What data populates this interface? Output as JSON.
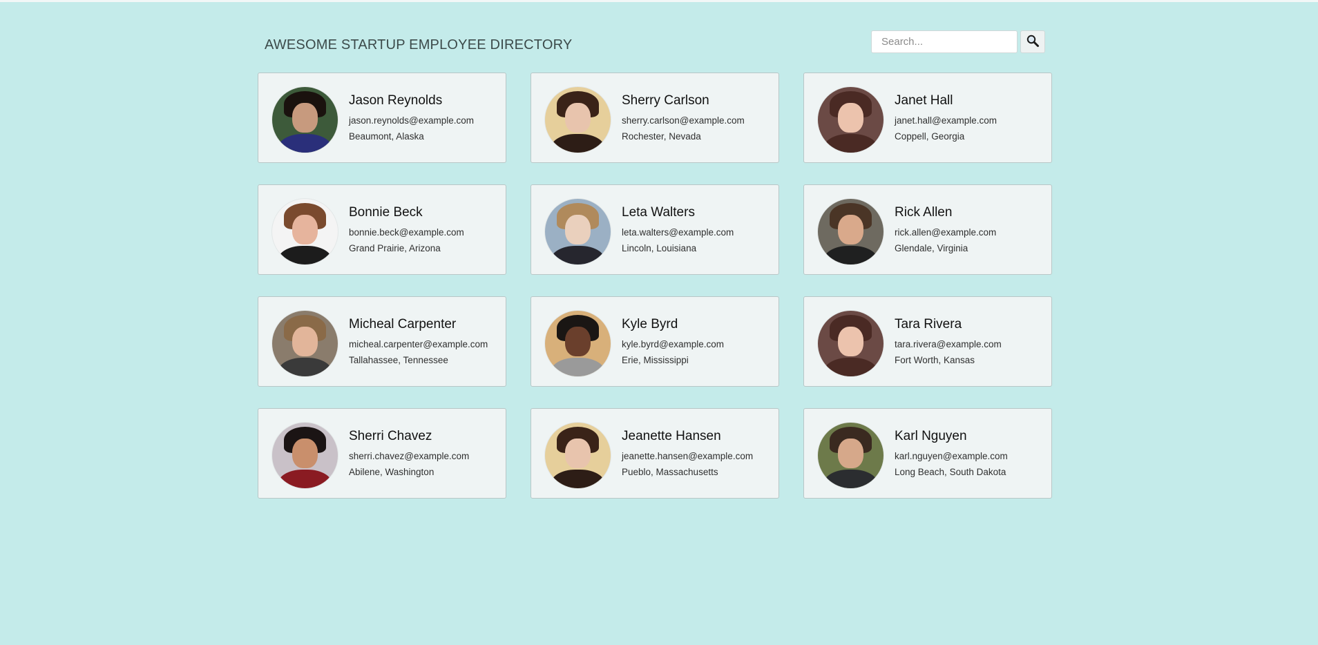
{
  "header": {
    "title": "Awesome Startup Employee Directory",
    "search_placeholder": "Search...",
    "search_icon": "magnifying-glass-icon"
  },
  "colors": {
    "background": "#c4ebea",
    "card": "#eff4f4",
    "card_border": "#b8c6c6"
  },
  "employees": [
    {
      "name": "Jason Reynolds",
      "email": "jason.reynolds@example.com",
      "location": "Beaumont, Alaska",
      "avatar": {
        "bg": "#3d5a3a",
        "hair": "#1a120e",
        "skin": "#c79a7e",
        "body": "#2a2f7a"
      }
    },
    {
      "name": "Sherry Carlson",
      "email": "sherry.carlson@example.com",
      "location": "Rochester, Nevada",
      "avatar": {
        "bg": "#e6cf9b",
        "hair": "#3a2318",
        "skin": "#e8c4ad",
        "body": "#2d1d16"
      }
    },
    {
      "name": "Janet Hall",
      "email": "janet.hall@example.com",
      "location": "Coppell, Georgia",
      "avatar": {
        "bg": "#6b4a45",
        "hair": "#4a2a24",
        "skin": "#ecc3ad",
        "body": "#4a2a24"
      }
    },
    {
      "name": "Bonnie Beck",
      "email": "bonnie.beck@example.com",
      "location": "Grand Prairie, Arizona",
      "avatar": {
        "bg": "#f4f4f4",
        "hair": "#7a4a2e",
        "skin": "#e6b49d",
        "body": "#1c1c1c"
      }
    },
    {
      "name": "Leta Walters",
      "email": "leta.walters@example.com",
      "location": "Lincoln, Louisiana",
      "avatar": {
        "bg": "#9bb0c4",
        "hair": "#b08a5c",
        "skin": "#ead0bd",
        "body": "#26262e"
      }
    },
    {
      "name": "Rick Allen",
      "email": "rick.allen@example.com",
      "location": "Glendale, Virginia",
      "avatar": {
        "bg": "#6e6a60",
        "hair": "#4a3526",
        "skin": "#d9a98b",
        "body": "#1f2020"
      }
    },
    {
      "name": "Micheal Carpenter",
      "email": "micheal.carpenter@example.com",
      "location": "Tallahassee, Tennessee",
      "avatar": {
        "bg": "#8a7c6c",
        "hair": "#8a6a48",
        "skin": "#e2b59a",
        "body": "#3a3a3a"
      }
    },
    {
      "name": "Kyle Byrd",
      "email": "kyle.byrd@example.com",
      "location": "Erie, Mississippi",
      "avatar": {
        "bg": "#d8b07a",
        "hair": "#1a1614",
        "skin": "#6a3f2c",
        "body": "#9a9a9a"
      }
    },
    {
      "name": "Tara Rivera",
      "email": "tara.rivera@example.com",
      "location": "Fort Worth, Kansas",
      "avatar": {
        "bg": "#6b4a45",
        "hair": "#4a2a24",
        "skin": "#ecc3ad",
        "body": "#4a2a24"
      }
    },
    {
      "name": "Sherri Chavez",
      "email": "sherri.chavez@example.com",
      "location": "Abilene, Washington",
      "avatar": {
        "bg": "#c9c1c8",
        "hair": "#1b1414",
        "skin": "#c98f6c",
        "body": "#8a1b22"
      }
    },
    {
      "name": "Jeanette Hansen",
      "email": "jeanette.hansen@example.com",
      "location": "Pueblo, Massachusetts",
      "avatar": {
        "bg": "#e6cf9b",
        "hair": "#3a2318",
        "skin": "#e8c4ad",
        "body": "#2d1d16"
      }
    },
    {
      "name": "Karl Nguyen",
      "email": "karl.nguyen@example.com",
      "location": "Long Beach, South Dakota",
      "avatar": {
        "bg": "#6d7a4a",
        "hair": "#3a2a20",
        "skin": "#d6a88a",
        "body": "#2b2d30"
      }
    }
  ]
}
